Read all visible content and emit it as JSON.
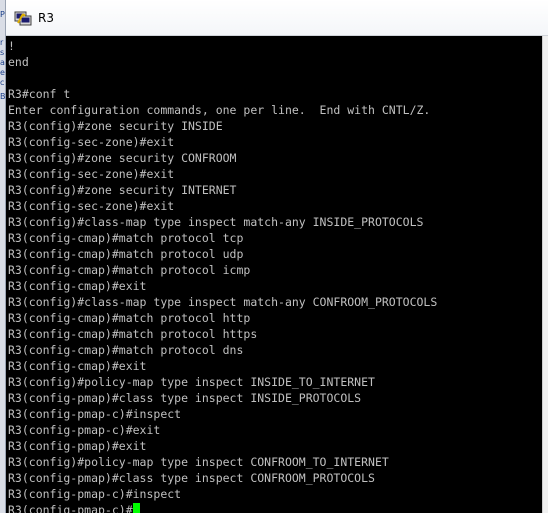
{
  "window": {
    "title": "R3"
  },
  "left_strip": {
    "marks": [
      "P",
      "r",
      "s",
      "a",
      "e",
      "c",
      "B"
    ]
  },
  "terminal": {
    "lines": [
      "!",
      "end",
      "",
      "R3#conf t",
      "Enter configuration commands, one per line.  End with CNTL/Z.",
      "R3(config)#zone security INSIDE",
      "R3(config-sec-zone)#exit",
      "R3(config)#zone security CONFROOM",
      "R3(config-sec-zone)#exit",
      "R3(config)#zone security INTERNET",
      "R3(config-sec-zone)#exit",
      "R3(config)#class-map type inspect match-any INSIDE_PROTOCOLS",
      "R3(config-cmap)#match protocol tcp",
      "R3(config-cmap)#match protocol udp",
      "R3(config-cmap)#match protocol icmp",
      "R3(config-cmap)#exit",
      "R3(config)#class-map type inspect match-any CONFROOM_PROTOCOLS",
      "R3(config-cmap)#match protocol http",
      "R3(config-cmap)#match protocol https",
      "R3(config-cmap)#match protocol dns",
      "R3(config-cmap)#exit",
      "R3(config)#policy-map type inspect INSIDE_TO_INTERNET",
      "R3(config-pmap)#class type inspect INSIDE_PROTOCOLS",
      "R3(config-pmap-c)#inspect",
      "R3(config-pmap-c)#exit",
      "R3(config-pmap)#exit",
      "R3(config)#policy-map type inspect CONFROOM_TO_INTERNET",
      "R3(config-pmap)#class type inspect CONFROOM_PROTOCOLS",
      "R3(config-pmap-c)#inspect"
    ],
    "prompt": "R3(config-pmap-c)#",
    "cursor_color": "#00ff00",
    "text_color": "#c0c0c0",
    "background_color": "#000000"
  },
  "icons": {
    "app": "putty-terminal-icon"
  }
}
